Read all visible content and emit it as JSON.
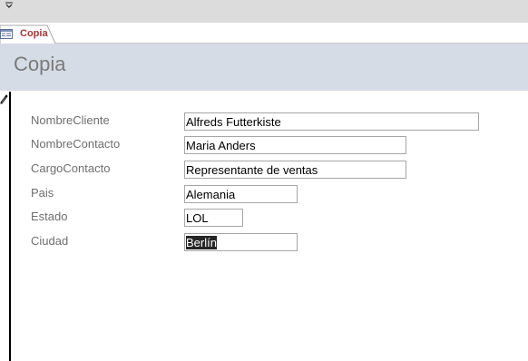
{
  "tab": {
    "label": "Copia",
    "accent_color": "#a4373a"
  },
  "header": {
    "title": "Copia",
    "band_color": "#d6dce6"
  },
  "fields": [
    {
      "label": "NombreCliente",
      "value": "Alfreds Futterkiste"
    },
    {
      "label": "NombreContacto",
      "value": "Maria Anders"
    },
    {
      "label": "CargoContacto",
      "value": "Representante de ventas"
    },
    {
      "label": "Pais",
      "value": "Alemania"
    },
    {
      "label": "Estado",
      "value": "LOL"
    },
    {
      "label": "Ciudad",
      "value": "Berlín"
    }
  ],
  "icons": {
    "qat": "chevron-down-icon",
    "tab": "form-icon",
    "record_selector": "pencil-icon"
  }
}
